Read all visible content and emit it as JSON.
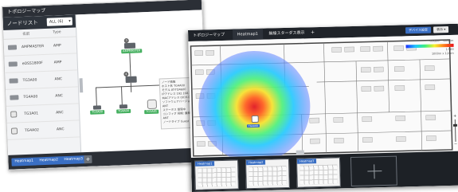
{
  "topology_window": {
    "title": "トポロジーマップ",
    "sidebar": {
      "heading": "ノードリスト",
      "filter_value": "ALL (6)",
      "columns": [
        "名前",
        "Type"
      ],
      "rows": [
        {
          "name": "AMPMASTER",
          "type": "AMP"
        },
        {
          "name": "eOSS1800F",
          "type": "AMP"
        },
        {
          "name": "TG3A00",
          "type": "ANC"
        },
        {
          "name": "TG4A00",
          "type": "ANC"
        },
        {
          "name": "TG3A01",
          "type": "ANC"
        },
        {
          "name": "TG4A02",
          "type": "ANC"
        }
      ]
    },
    "nodes": {
      "master": "AMPMASTER",
      "sw": "eOSS",
      "ap1": "TG3A00",
      "ap2": "TG4A00",
      "ap3": "TG3A01",
      "node_num_top": "3",
      "node_num_mid": "4"
    },
    "info_popup": {
      "lines": [
        "ノード情報",
        "ホスト名 TG4A00",
        "モデル AT-TQ4600",
        "IPアドレス 192.168.10",
        "MACアドレス 0019.00",
        "ソフトウェアバージョン",
        "",
        "ANT",
        "ステータス 管理中",
        "コンフィグ 同期: 最新",
        "ANT",
        "ノードタイプ Guest"
      ]
    },
    "tabs": [
      "Heatmap1",
      "Heatmap2",
      "Heatmap3"
    ],
    "add_tab": "+"
  },
  "heatmap_window": {
    "breadcrumb": "トポロジーマップ",
    "active_tab": "Heatmap1",
    "second_tab": "無線スターダス表示",
    "add_tab": "+",
    "btn_primary": "デバイス設定",
    "btn_secondary": "表示 ▾",
    "legend": {
      "min_label": "-55dBm",
      "max_label": "-20dBm",
      "scale_label": "1:500",
      "scale_size": "1000m x 12mm"
    },
    "ap_label": "TG4A00",
    "zoom_plus": "+",
    "zoom_minus": "−",
    "thumbnails": [
      "Heatmap1",
      "Heatmap2",
      "Heatmap3"
    ]
  },
  "colors": {
    "accent_blue": "#3a6fc4",
    "node_green": "#46b060",
    "titlebar_dark": "#1f2329"
  }
}
